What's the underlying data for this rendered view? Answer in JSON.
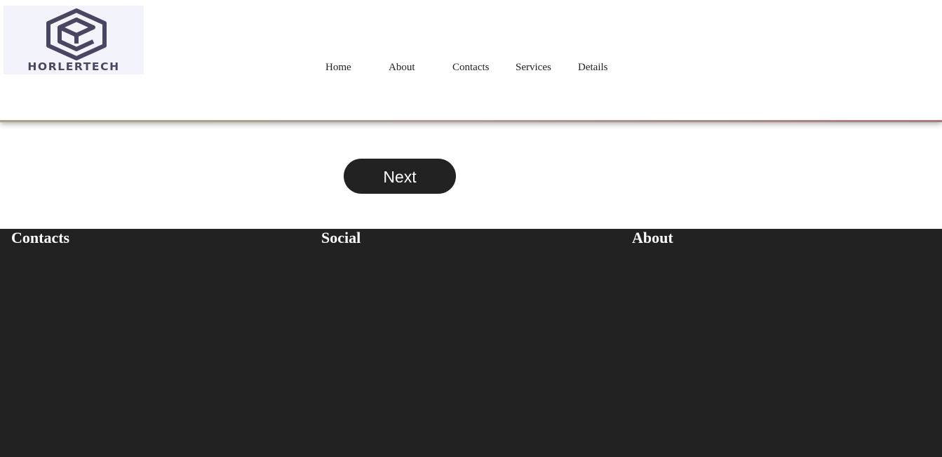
{
  "brand": {
    "name": "HORLERTECH",
    "logo_icon": "hexagon-cube-icon",
    "logo_color": "#4a4560",
    "logo_bg": "#f3f3fb"
  },
  "nav": {
    "items": [
      {
        "label": "Home"
      },
      {
        "label": "About"
      },
      {
        "label": "Contacts"
      },
      {
        "label": "Services"
      },
      {
        "label": "Details"
      }
    ]
  },
  "main": {
    "next_label": "Next"
  },
  "footer": {
    "columns": [
      {
        "title": "Contacts"
      },
      {
        "title": "Social"
      },
      {
        "title": "About"
      }
    ]
  },
  "colors": {
    "dark": "#222222",
    "text_light": "#ffffff"
  }
}
